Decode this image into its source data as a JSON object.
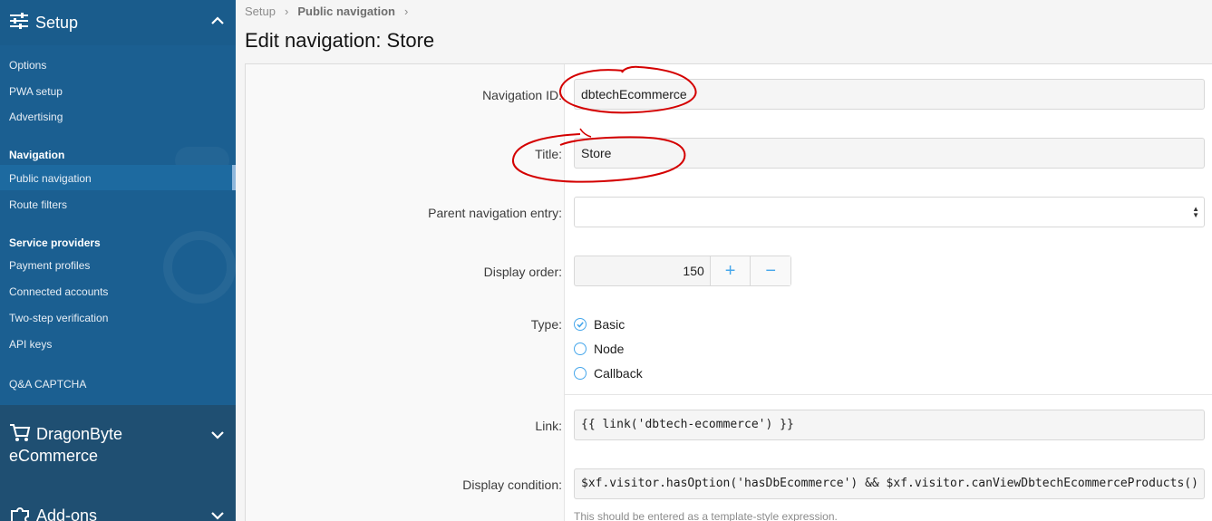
{
  "sidebar": {
    "setup_label": "Setup",
    "items": [
      {
        "label": "Options"
      },
      {
        "label": "PWA setup"
      },
      {
        "label": "Advertising"
      }
    ],
    "group_navigation": "Navigation",
    "nav_items": [
      {
        "label": "Public navigation",
        "active": true
      },
      {
        "label": "Route filters"
      }
    ],
    "group_service": "Service providers",
    "service_items": [
      {
        "label": "Payment profiles"
      },
      {
        "label": "Connected accounts"
      },
      {
        "label": "Two-step verification"
      },
      {
        "label": "API keys"
      }
    ],
    "captcha_label": "Q&A CAPTCHA",
    "ecommerce_label_line1": "DragonByte",
    "ecommerce_label_line2": "eCommerce",
    "addons_label": "Add-ons"
  },
  "breadcrumb": {
    "items": [
      "Setup",
      "Public navigation"
    ]
  },
  "page_title": "Edit navigation: Store",
  "form": {
    "navigation_id_label": "Navigation ID:",
    "navigation_id_value": "dbtechEcommerce",
    "title_label": "Title:",
    "title_value": "Store",
    "parent_label": "Parent navigation entry:",
    "parent_value": "",
    "display_order_label": "Display order:",
    "display_order_value": "150",
    "plus_glyph": "+",
    "minus_glyph": "−",
    "type_label": "Type:",
    "type_options": [
      "Basic",
      "Node",
      "Callback"
    ],
    "type_selected": "Basic",
    "link_label": "Link:",
    "link_value": "{{ link('dbtech-ecommerce') }}",
    "condition_label": "Display condition:",
    "condition_value": "$xf.visitor.hasOption('hasDbEcommerce') && $xf.visitor.canViewDbtechEcommerceProducts()",
    "condition_hint": "This should be entered as a template-style expression."
  },
  "colors": {
    "sidebar": "#185886",
    "accent": "#47a7eb",
    "annotation": "#d40000"
  }
}
